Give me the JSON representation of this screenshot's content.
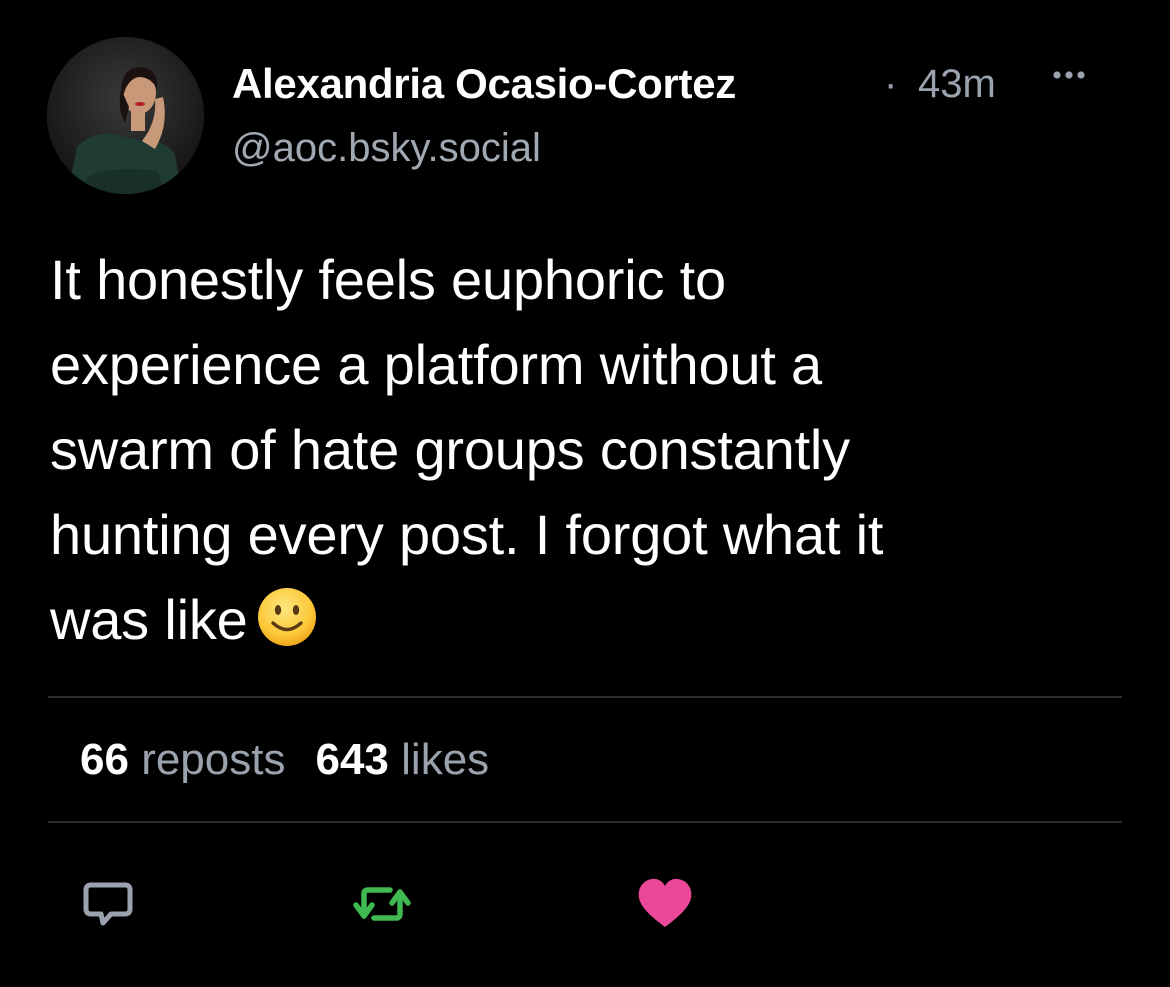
{
  "post": {
    "author": {
      "display_name": "Alexandria Ocasio-Cortez",
      "handle": "@aoc.bsky.social",
      "avatar_icon": "profile-photo-avatar"
    },
    "separator": "·",
    "timestamp": "43m",
    "more_icon": "ellipsis-icon",
    "text_lines": [
      "It honestly feels euphoric to",
      "experience a platform without a",
      "swarm of hate groups constantly",
      "hunting every post. I forgot what it",
      "was like"
    ],
    "emoji": "slightly-smiling-face-emoji",
    "stats": {
      "reposts_count": "66",
      "reposts_label": "reposts",
      "likes_count": "643",
      "likes_label": "likes"
    },
    "actions": {
      "reply_icon": "speech-bubble-icon",
      "repost_icon": "repost-arrows-icon",
      "like_icon": "heart-icon"
    }
  },
  "colors": {
    "background": "#000000",
    "text_primary": "#ffffff",
    "text_secondary": "#9aa3ad",
    "divider": "#2a2e33",
    "reply_icon": "#9aa3ad",
    "repost_icon_active": "#3fb950",
    "like_icon_active": "#ec4899"
  }
}
